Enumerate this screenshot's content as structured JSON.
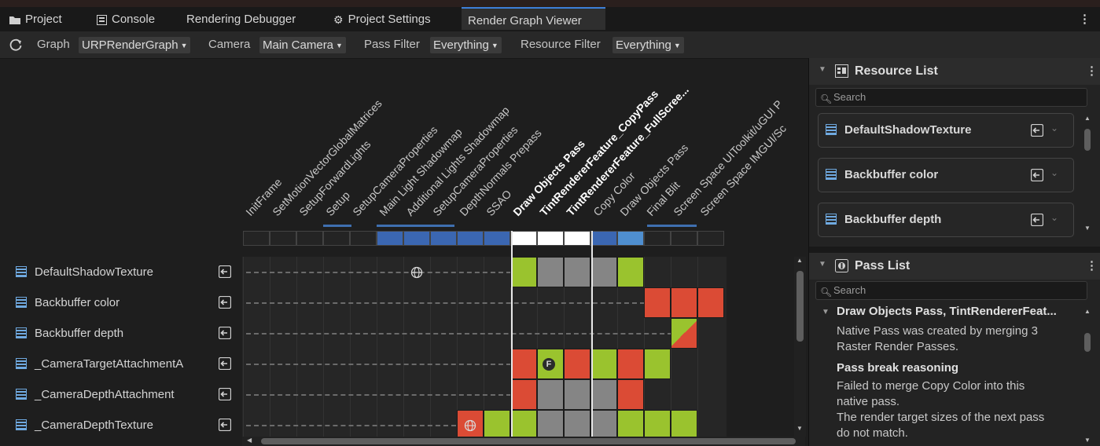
{
  "tabs": [
    {
      "label": "Project",
      "icon": "folder-icon"
    },
    {
      "label": "Console",
      "icon": "console-icon"
    },
    {
      "label": "Rendering Debugger",
      "icon": ""
    },
    {
      "label": "Project Settings",
      "icon": "gear-icon"
    },
    {
      "label": "Render Graph Viewer",
      "icon": "",
      "active": true
    }
  ],
  "toolbar": {
    "graph_label": "Graph",
    "graph_value": "URPRenderGraph",
    "camera_label": "Camera",
    "camera_value": "Main Camera",
    "pass_filter_label": "Pass Filter",
    "pass_filter_value": "Everything",
    "resource_filter_label": "Resource Filter",
    "resource_filter_value": "Everything"
  },
  "passes": [
    {
      "name": "InitFrame",
      "bold": false
    },
    {
      "name": "SetMotionVectorGlobalMatrices",
      "bold": false
    },
    {
      "name": "SetupForwardLights",
      "bold": false
    },
    {
      "name": "Setup",
      "bold": false
    },
    {
      "name": "SetupCameraProperties",
      "bold": false
    },
    {
      "name": "Main Light Shadowmap",
      "bold": false
    },
    {
      "name": "Additional Lights Shadowmap",
      "bold": false
    },
    {
      "name": "SetupCameraProperties",
      "bold": false
    },
    {
      "name": "DepthNormals Prepass",
      "bold": false
    },
    {
      "name": "SSAO",
      "bold": false
    },
    {
      "name": "Draw Objects Pass",
      "bold": true
    },
    {
      "name": "TintRendererFeature_CopyPass",
      "bold": true
    },
    {
      "name": "TintRendererFeature_FullScree...",
      "bold": true
    },
    {
      "name": "Copy Color",
      "bold": false
    },
    {
      "name": "Draw Objects Pass",
      "bold": false
    },
    {
      "name": "Final Blit",
      "bold": false
    },
    {
      "name": "Screen Space UIToolkit/uGUI P",
      "bold": false
    },
    {
      "name": "Screen Space IMGUI/Sc",
      "bold": false
    }
  ],
  "resources": [
    {
      "name": "DefaultShadowTexture"
    },
    {
      "name": "Backbuffer color"
    },
    {
      "name": "Backbuffer depth"
    },
    {
      "name": "_CameraTargetAttachmentA"
    },
    {
      "name": "_CameraDepthAttachment"
    },
    {
      "name": "_CameraDepthTexture"
    }
  ],
  "colors": {
    "write_green": "#9ac32e",
    "read_gray": "#858585",
    "read_write_red": "#db4b35",
    "merged_white": "#ffffff",
    "native_blue": "#3b67b2",
    "light_blue": "#4f8fd0"
  },
  "resource_list": {
    "title": "Resource List",
    "search_placeholder": "Search",
    "items": [
      {
        "name": "DefaultShadowTexture"
      },
      {
        "name": "Backbuffer color"
      },
      {
        "name": "Backbuffer depth"
      }
    ]
  },
  "pass_list": {
    "title": "Pass List",
    "search_placeholder": "Search",
    "item_title": "Draw Objects Pass, TintRendererFeat...",
    "line1": "Native Pass was created by merging 3",
    "line2": "Raster Render Passes.",
    "break_heading": "Pass break reasoning",
    "break_line1": "Failed to merge Copy Color into this",
    "break_line2": "native pass.",
    "break_line3": "The render target sizes of the next pass",
    "break_line4": "do not match."
  },
  "cell_markers": {
    "globe": "globe-icon",
    "f_badge": "F"
  }
}
